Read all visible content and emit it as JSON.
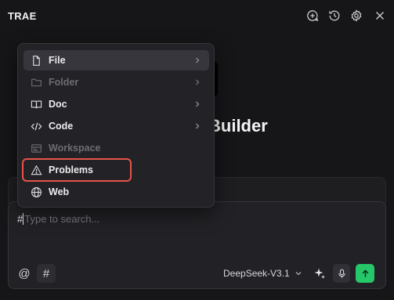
{
  "app": {
    "title": "TRAE"
  },
  "header_icons": [
    "new-chat-icon",
    "history-icon",
    "settings-icon",
    "close-icon"
  ],
  "background": {
    "title_fragment": "Builder"
  },
  "menu": {
    "items": [
      {
        "label": "File",
        "icon": "file-icon",
        "enabled": true,
        "submenu": true
      },
      {
        "label": "Folder",
        "icon": "folder-icon",
        "enabled": false,
        "submenu": true
      },
      {
        "label": "Doc",
        "icon": "book-icon",
        "enabled": true,
        "submenu": true
      },
      {
        "label": "Code",
        "icon": "code-icon",
        "enabled": true,
        "submenu": true
      },
      {
        "label": "Workspace",
        "icon": "workspace-icon",
        "enabled": false,
        "submenu": false
      },
      {
        "label": "Problems",
        "icon": "warning-icon",
        "enabled": true,
        "submenu": false
      },
      {
        "label": "Web",
        "icon": "globe-icon",
        "enabled": true,
        "submenu": false
      }
    ]
  },
  "chat": {
    "prefix": "#",
    "placeholder": "Type to search...",
    "at_label": "@",
    "hash_label": "#",
    "model": "DeepSeek-V3.1"
  },
  "colors": {
    "background": "#161618",
    "menu_bg": "#232327",
    "highlight_outline": "#e5534b",
    "send_button": "#26c66a"
  }
}
